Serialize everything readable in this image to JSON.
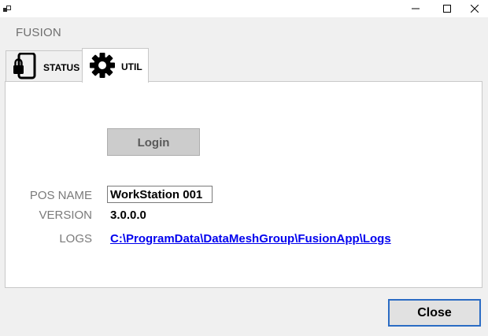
{
  "window": {
    "icons": {
      "app": "app-icon",
      "minimize": "minimize-icon",
      "maximize": "maximize-icon",
      "close": "close-icon"
    }
  },
  "brand": "FUSION",
  "tabs": [
    {
      "label": "STATUS",
      "icon": "phone-lock-icon",
      "active": false
    },
    {
      "label": "UTIL",
      "icon": "gear-icon",
      "active": true
    }
  ],
  "util": {
    "login_label": "Login",
    "pos_name_label": "POS NAME",
    "pos_name_value": "WorkStation 001",
    "version_label": "VERSION",
    "version_value": "3.0.0.0",
    "logs_label": "LOGS",
    "logs_path": "C:\\ProgramData\\DataMeshGroup\\FusionApp\\Logs"
  },
  "footer": {
    "close_label": "Close"
  },
  "colors": {
    "accent": "#2b6cc4",
    "link": "#0000ee",
    "label_gray": "#7a7a7a"
  }
}
